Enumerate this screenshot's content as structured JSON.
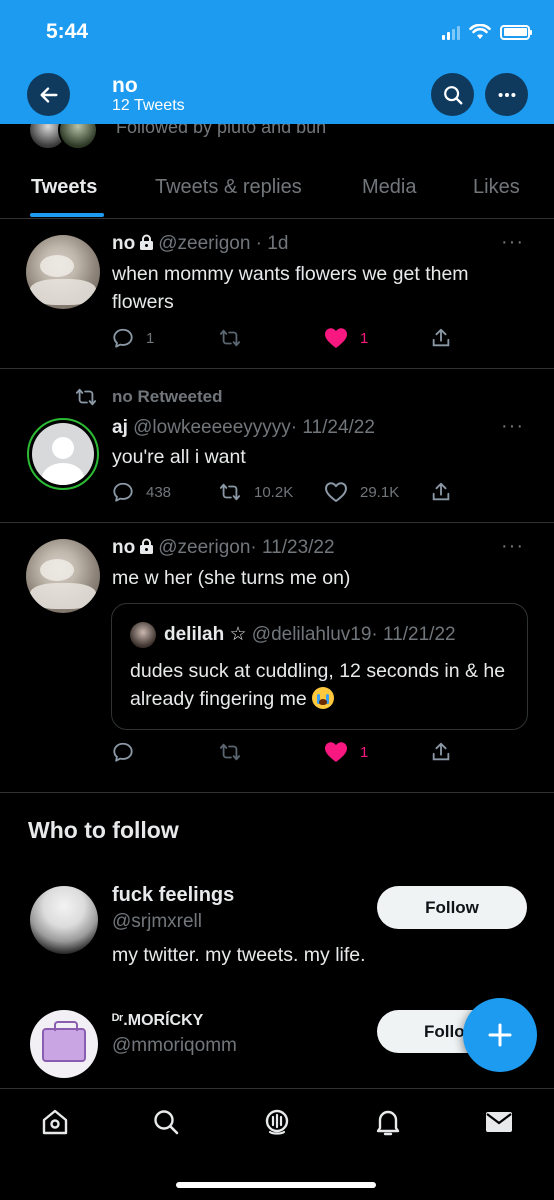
{
  "status_bar": {
    "time": "5:44"
  },
  "header": {
    "title": "no",
    "subtitle": "12 Tweets"
  },
  "profile": {
    "followed_by": "Followed by pluto and bun"
  },
  "tabs": [
    {
      "label": "Tweets",
      "active": true
    },
    {
      "label": "Tweets & replies",
      "active": false
    },
    {
      "label": "Media",
      "active": false
    },
    {
      "label": "Likes",
      "active": false
    }
  ],
  "tweets": [
    {
      "name": "no",
      "handle": "@zeerigon",
      "time": "· 1d",
      "text": "when mommy wants flowers we get them flowers",
      "replies": "1",
      "retweets": "",
      "likes": "1",
      "liked": true,
      "protected": true
    },
    {
      "retweeted_by": "no Retweeted",
      "name": "aj",
      "handle": "@lowkeeeeeyyyyy",
      "time": "· 11/24/22",
      "text": "you're all i want",
      "replies": "438",
      "retweets": "10.2K",
      "likes": "29.1K",
      "liked": false,
      "protected": false
    },
    {
      "name": "no",
      "handle": "@zeerigon",
      "time": "· 11/23/22",
      "text": "me w her (she turns me on)",
      "replies": "",
      "retweets": "",
      "likes": "1",
      "liked": true,
      "protected": true,
      "quote": {
        "name": "delilah ☆",
        "handle": "@delilahluv19",
        "time": "· 11/21/22",
        "text": "dudes suck at cuddling, 12 seconds in & he already fingering me"
      }
    }
  ],
  "who_to_follow": {
    "title": "Who to follow",
    "items": [
      {
        "name": "fuck feelings",
        "handle": "@srjmxrell",
        "bio": "my twitter. my tweets. my life.",
        "button": "Follow"
      },
      {
        "name": "ᴰʳ.MORÍCKY",
        "handle": "@mmoriqomm",
        "button": "Follow"
      }
    ]
  },
  "colors": {
    "accent": "#1d9bf0",
    "like": "#f91880",
    "muted": "#71767b",
    "background": "#000000"
  }
}
